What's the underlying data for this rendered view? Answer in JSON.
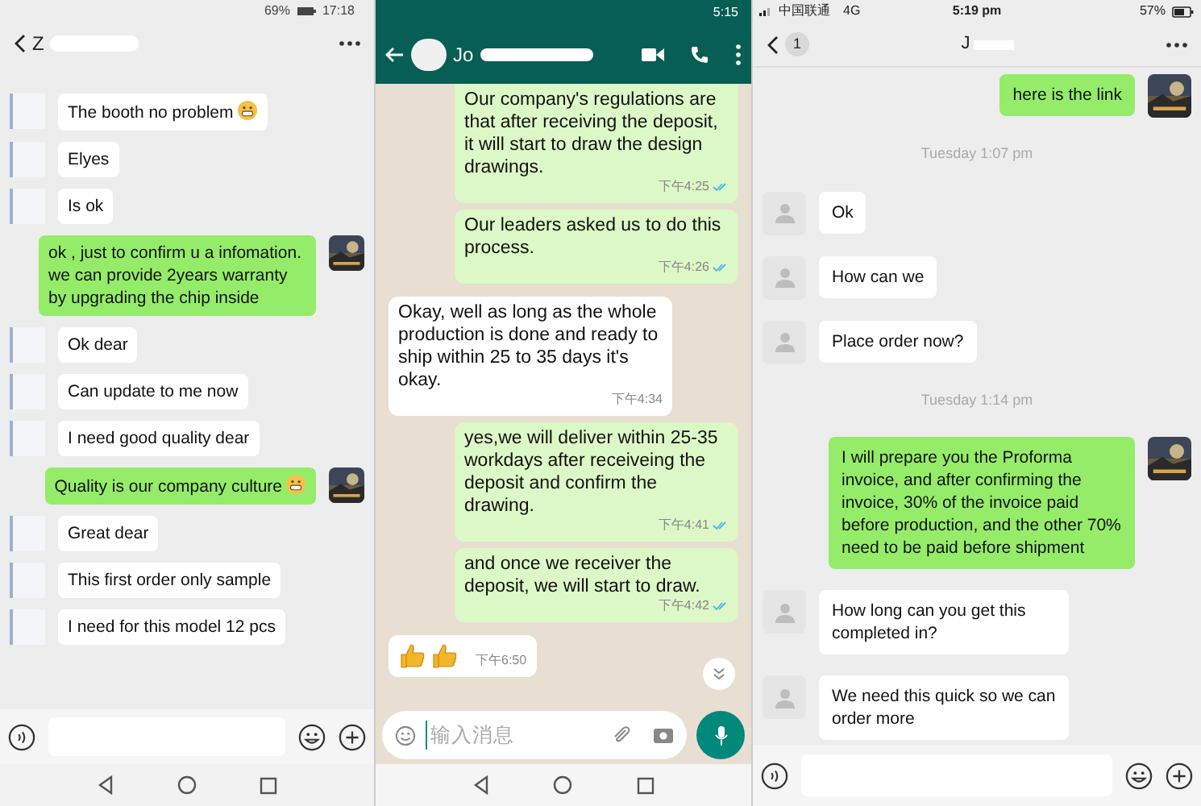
{
  "left": {
    "status": {
      "battery": "69%",
      "time": "17:18"
    },
    "header": {
      "title": "Z"
    },
    "messages": [
      {
        "kind": "in",
        "text": "The booth no problem",
        "emoji": true
      },
      {
        "kind": "in",
        "text": "Elyes"
      },
      {
        "kind": "in",
        "text": "Is ok"
      },
      {
        "kind": "out",
        "text": "ok , just to confirm u a infomation. we can provide 2years warranty by upgrading the chip inside"
      },
      {
        "kind": "in",
        "text": "Ok dear"
      },
      {
        "kind": "in",
        "text": "Can update to me now"
      },
      {
        "kind": "in",
        "text": "I need good quality dear"
      },
      {
        "kind": "out",
        "text": "Quality is our company culture",
        "emoji": true
      },
      {
        "kind": "in",
        "text": "Great dear"
      },
      {
        "kind": "in",
        "text": "This first order only sample"
      },
      {
        "kind": "in",
        "text": "I need for this model 12 pcs"
      }
    ]
  },
  "middle": {
    "status": {
      "time": "5:15"
    },
    "header": {
      "title": "Jo"
    },
    "messages": [
      {
        "kind": "out",
        "text": "Our company's regulations are that after receiving the deposit, it will start to draw the design drawings.",
        "time": "下午4:25",
        "read": true
      },
      {
        "kind": "out",
        "text": "Our leaders asked us to do this process.",
        "time": "下午4:26",
        "read": true
      },
      {
        "kind": "in",
        "text": "Okay, well as long as the whole production is done and ready to ship within 25 to 35 days it's okay.",
        "time": "下午4:34"
      },
      {
        "kind": "out",
        "text": "yes,we will deliver within 25-35 workdays after receiveing the deposit and confirm the drawing.",
        "time": "下午4:41",
        "read": true
      },
      {
        "kind": "out",
        "text": "and once we receiver the deposit, we will start to draw.",
        "time": "下午4:42",
        "read": true
      },
      {
        "kind": "thumbs",
        "time": "下午6:50"
      }
    ],
    "input": {
      "placeholder": "输入消息"
    }
  },
  "right": {
    "status": {
      "carrier": "中国联通",
      "network": "4G",
      "time": "5:19 pm",
      "battery": "57%"
    },
    "header": {
      "badge": "1",
      "title": "J"
    },
    "messages": [
      {
        "kind": "out",
        "text": "here is the link"
      },
      {
        "kind": "time",
        "text": "Tuesday 1:07 pm"
      },
      {
        "kind": "in",
        "text": "Ok"
      },
      {
        "kind": "in",
        "text": "How can we"
      },
      {
        "kind": "in",
        "text": "Place order now?"
      },
      {
        "kind": "time",
        "text": "Tuesday 1:14 pm"
      },
      {
        "kind": "out",
        "text": "I will prepare you the Proforma invoice, and after confirming the invoice, 30% of the invoice paid before production, and the other 70% need to be paid before shipment"
      },
      {
        "kind": "in",
        "text": "How long can you get this completed in?"
      },
      {
        "kind": "in",
        "text": "We need this quick so we can order more"
      }
    ]
  }
}
